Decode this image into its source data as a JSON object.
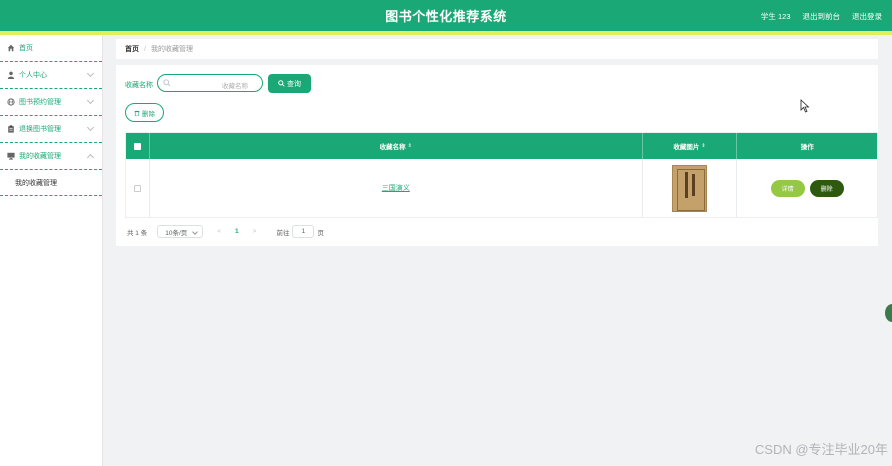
{
  "header": {
    "title": "图书个性化推荐系统",
    "user": "学生 123",
    "back_front": "退出到前台",
    "logout": "退出登录"
  },
  "sidebar": {
    "items": [
      {
        "label": "首页",
        "icon": "home-icon"
      },
      {
        "label": "个人中心",
        "icon": "user-icon"
      },
      {
        "label": "图书预约管理",
        "icon": "globe-icon"
      },
      {
        "label": "退换图书管理",
        "icon": "clipboard-icon"
      },
      {
        "label": "我的收藏管理",
        "icon": "monitor-icon"
      }
    ],
    "submenu": "我的收藏管理"
  },
  "breadcrumb": {
    "home": "首页",
    "separator": "/",
    "current": "我的收藏管理"
  },
  "search": {
    "label": "收藏名称",
    "placeholder": "收藏名称",
    "query_button": "查询"
  },
  "actions": {
    "delete_button": "删除"
  },
  "table": {
    "headers": [
      "收藏名称",
      "收藏图片",
      "操作"
    ],
    "rows": [
      {
        "name": "三国演义",
        "detail": "详情",
        "delete": "删除"
      }
    ]
  },
  "pagination": {
    "total": "共 1 条",
    "page_size": "10条/页",
    "prev": "<",
    "current_page": "1",
    "next": ">",
    "goto_label": "前往",
    "goto_value": "1",
    "goto_unit": "页"
  },
  "watermark": "CSDN @专注毕业20年",
  "colors": {
    "primary": "#1aa876",
    "accent_bar": "#dff05a",
    "detail_button": "#95c943",
    "delete_button": "#2d5a0f"
  }
}
